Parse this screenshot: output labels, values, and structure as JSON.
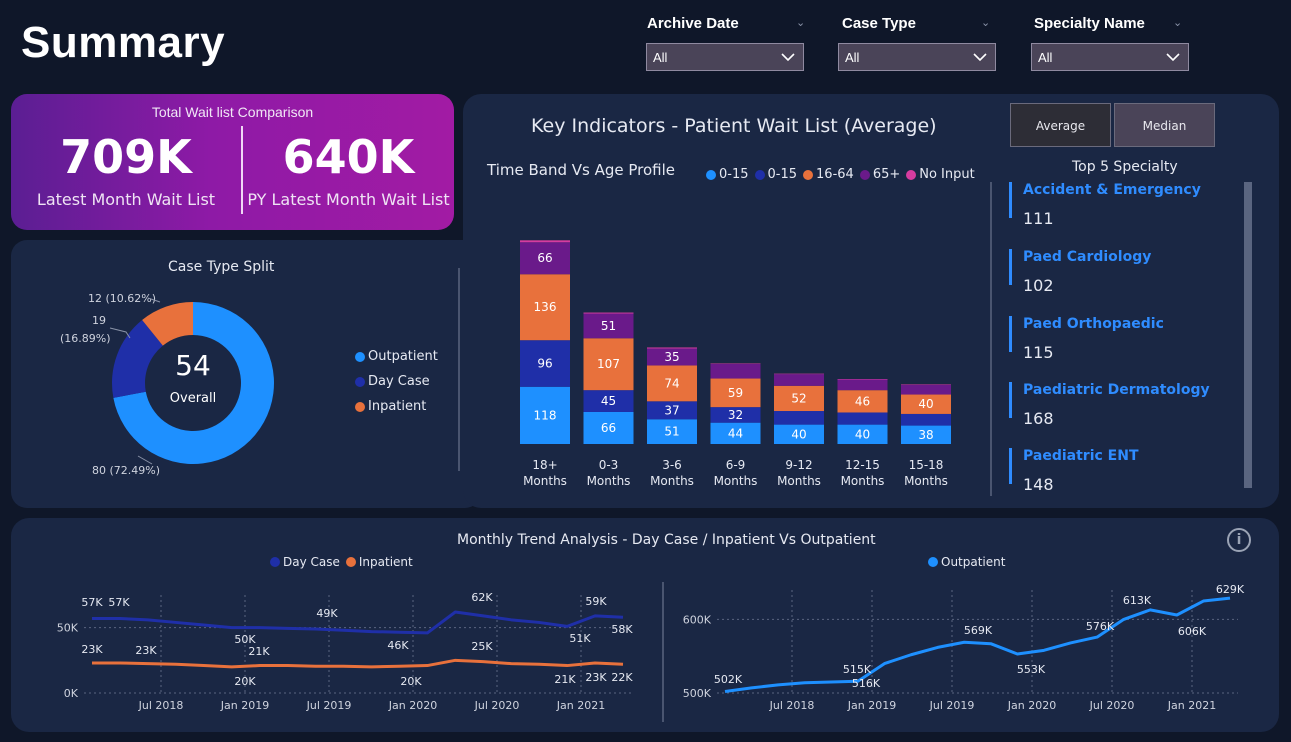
{
  "header": {
    "title": "Summary",
    "filters": [
      {
        "label": "Archive Date",
        "value": "All"
      },
      {
        "label": "Case Type",
        "value": "All"
      },
      {
        "label": "Specialty Name",
        "value": "All"
      }
    ]
  },
  "kpi": {
    "title": "Total Wait list Comparison",
    "latest_value": "709K",
    "latest_label": "Latest Month Wait List",
    "py_value": "640K",
    "py_label": "PY Latest Month Wait List"
  },
  "key_indicators": {
    "title": "Key Indicators - Patient Wait List (Average)",
    "buttons": {
      "average": "Average",
      "median": "Median"
    }
  },
  "top_specialty": {
    "title": "Top 5 Specialty",
    "items": [
      {
        "name": "Accident & Emergency",
        "value": "111"
      },
      {
        "name": "Paed Cardiology",
        "value": "102"
      },
      {
        "name": "Paed Orthopaedic",
        "value": "115"
      },
      {
        "name": "Paediatric Dermatology",
        "value": "168"
      },
      {
        "name": "Paediatric ENT",
        "value": "148"
      }
    ]
  },
  "colors": {
    "light_blue": "#1e90ff",
    "dark_blue": "#1f2fa8",
    "orange": "#e8713c",
    "purple": "#6a1a8a",
    "pink": "#d63ca0",
    "outpatient_line": "#1e90ff",
    "daycase_line": "#1f2fa8",
    "inpatient_line": "#e8713c"
  },
  "chart_data": [
    {
      "type": "pie",
      "title": "Case Type Split",
      "center_value": "54",
      "center_label": "Overall",
      "legend": [
        "Outpatient",
        "Day Case",
        "Inpatient"
      ],
      "slices": [
        {
          "name": "Outpatient",
          "value": 80,
          "label": "80 (72.49%)"
        },
        {
          "name": "Day Case",
          "value": 19,
          "label_line1": "19",
          "label_line2": "(16.89%)"
        },
        {
          "name": "Inpatient",
          "value": 12,
          "label": "12 (10.62%)"
        }
      ]
    },
    {
      "type": "bar",
      "title": "Time Band Vs Age Profile",
      "legend": [
        "0-15",
        "0-15",
        "16-64",
        "65+",
        "No Input"
      ],
      "categories": [
        {
          "line1": "18+",
          "line2": "Months"
        },
        {
          "line1": "0-3",
          "line2": "Months"
        },
        {
          "line1": "3-6",
          "line2": "Months"
        },
        {
          "line1": "6-9",
          "line2": "Months"
        },
        {
          "line1": "9-12",
          "line2": "Months"
        },
        {
          "line1": "12-15",
          "line2": "Months"
        },
        {
          "line1": "15-18",
          "line2": "Months"
        }
      ],
      "series": [
        {
          "name": "0-15",
          "values": [
            118,
            66,
            51,
            44,
            40,
            40,
            38
          ]
        },
        {
          "name": "0-15",
          "values": [
            96,
            45,
            37,
            32,
            28,
            25,
            24
          ]
        },
        {
          "name": "16-64",
          "values": [
            136,
            107,
            74,
            59,
            52,
            46,
            40
          ]
        },
        {
          "name": "65+",
          "values": [
            66,
            51,
            35,
            30,
            24,
            22,
            20
          ]
        },
        {
          "name": "No Input",
          "values": [
            4,
            2,
            2,
            1,
            1,
            1,
            1
          ]
        }
      ],
      "shown_labels": [
        [
          "118",
          "96",
          "136",
          "66"
        ],
        [
          "66",
          "45",
          "107",
          "51"
        ],
        [
          "51",
          "37",
          "74",
          "35"
        ],
        [
          "44",
          "32",
          "59",
          ""
        ],
        [
          "40",
          "",
          "52",
          ""
        ],
        [
          "40",
          "",
          "46",
          ""
        ],
        [
          "38",
          "",
          "40",
          ""
        ]
      ]
    },
    {
      "type": "line",
      "title": "Monthly Trend Analysis - Day Case / Inpatient Vs Outpatient",
      "legend": [
        "Day Case",
        "Inpatient"
      ],
      "x_ticks": [
        "Jul 2018",
        "Jan 2019",
        "Jul 2019",
        "Jan 2020",
        "Jul 2020",
        "Jan 2021"
      ],
      "y_ticks": [
        "50K",
        "0K"
      ],
      "ylim": [
        0,
        75000
      ],
      "series": [
        {
          "name": "Day Case",
          "values": [
            57000,
            57000,
            56000,
            54000,
            52000,
            50000,
            50000,
            49500,
            49000,
            48000,
            47000,
            46500,
            46000,
            62000,
            59000,
            56000,
            54000,
            51000,
            59000,
            58000
          ]
        },
        {
          "name": "Inpatient",
          "values": [
            23000,
            23000,
            22500,
            22000,
            21000,
            20000,
            21000,
            21000,
            20500,
            20500,
            20000,
            20500,
            21000,
            25000,
            24000,
            22500,
            22000,
            21000,
            23000,
            22000
          ]
        }
      ],
      "labels": [
        "57K",
        "57K",
        "49K",
        "50K",
        "46K",
        "62K",
        "59K",
        "51K",
        "58K",
        "23K",
        "23K",
        "21K",
        "20K",
        "20K",
        "25K",
        "21K",
        "23K",
        "22K"
      ]
    },
    {
      "type": "line",
      "legend": [
        "Outpatient"
      ],
      "x_ticks": [
        "Jul 2018",
        "Jan 2019",
        "Jul 2019",
        "Jan 2020",
        "Jul 2020",
        "Jan 2021"
      ],
      "y_ticks": [
        "600K",
        "500K"
      ],
      "ylim": [
        500000,
        640000
      ],
      "series": [
        {
          "name": "Outpatient",
          "values": [
            502000,
            507000,
            511000,
            514000,
            515000,
            516000,
            540000,
            552000,
            562000,
            569000,
            567000,
            553000,
            558000,
            568000,
            576000,
            600000,
            613000,
            606000,
            625000,
            629000
          ]
        }
      ],
      "labels": [
        "502K",
        "515K",
        "516K",
        "569K",
        "553K",
        "576K",
        "613K",
        "606K",
        "629K"
      ]
    }
  ]
}
